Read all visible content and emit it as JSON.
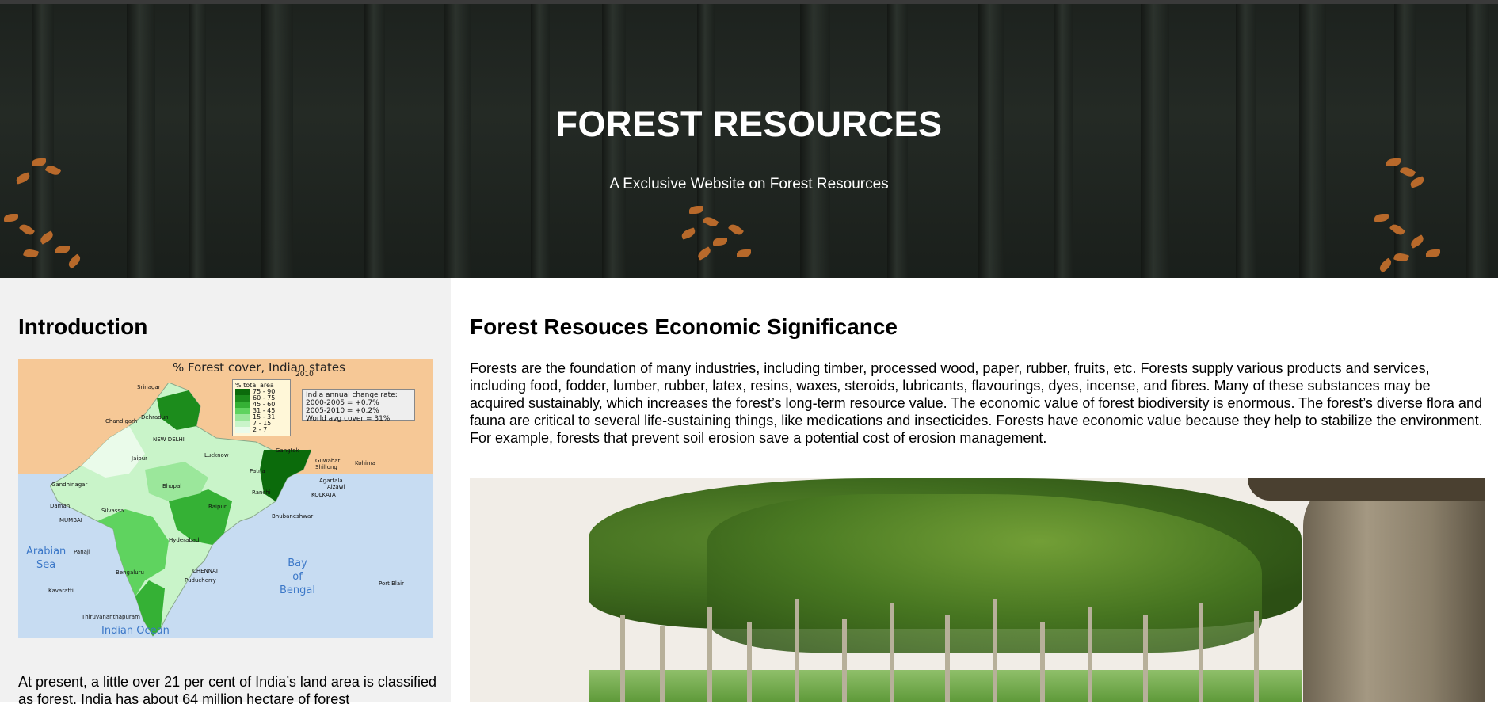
{
  "hero": {
    "title": "FOREST RESOURCES",
    "subtitle": "A Exclusive Website on Forest Resources"
  },
  "sidebar": {
    "heading": "Introduction",
    "map": {
      "title": "% Forest cover, Indian states",
      "legend_title": "% total area",
      "legend_year": "2010",
      "legend_items": [
        {
          "label": "75 - 90",
          "color": "#0b6b0b"
        },
        {
          "label": "60 - 75",
          "color": "#1c8c1c"
        },
        {
          "label": "45 - 60",
          "color": "#35b135"
        },
        {
          "label": "31 - 45",
          "color": "#5fd35f"
        },
        {
          "label": "15 - 31",
          "color": "#9be79b"
        },
        {
          "label": "7 - 15",
          "color": "#c9f4c9"
        },
        {
          "label": "2 - 7",
          "color": "#eafbea"
        }
      ],
      "rate_lines": [
        "India annual change rate:",
        "2000-2005 = +0.7%",
        "2005-2010 = +0.2%",
        "World avg cover = 31%"
      ],
      "seas": {
        "arabian": "Arabian\nSea",
        "bengal": "Bay\nof\nBengal",
        "indian_ocean": "Indian Ocean"
      },
      "cities": [
        "Srinagar",
        "Chandigarh",
        "Dehradun",
        "NEW DELHI",
        "Jaipur",
        "Lucknow",
        "Gangtok",
        "Guwahati",
        "Shillong",
        "Patna",
        "Kohima",
        "Gandhinagar",
        "Bhopal",
        "Ranchi",
        "Agartala",
        "Aizawl",
        "KOLKATA",
        "Raipur",
        "Daman",
        "Silvassa",
        "Bhubaneshwar",
        "MUMBAI",
        "Hyderabad",
        "Panaji",
        "Bengaluru",
        "CHENNAI",
        "Puducherry",
        "Kavaratti",
        "Thiruvananthapuram",
        "Port Blair"
      ]
    },
    "text": "At present, a little over 21 per cent of India’s land area is classified as forest. India has about 64 million hectare of forest"
  },
  "main": {
    "heading": "Forest Resouces Economic Significance",
    "text": "Forests are the foundation of many industries, including timber, processed wood, paper, rubber, fruits, etc. Forests supply various products and services, including food, fodder, lumber, rubber, latex, resins, waxes, steroids, lubricants, flavourings, dyes, incense, and fibres. Many of these substances may be acquired sustainably, which increases the forest’s long-term resource value. The economic value of forest biodiversity is enormous. The forest’s diverse flora and fauna are critical to several life-sustaining things, like medications and insecticides. Forests have economic value because they help to stabilize the environment. For example, forests that prevent soil erosion save a potential cost of erosion management."
  },
  "colors": {
    "sidebar_bg": "#f1f1f1",
    "hero_bg": "#1d221e",
    "leaf_orange": "#c9712c"
  }
}
